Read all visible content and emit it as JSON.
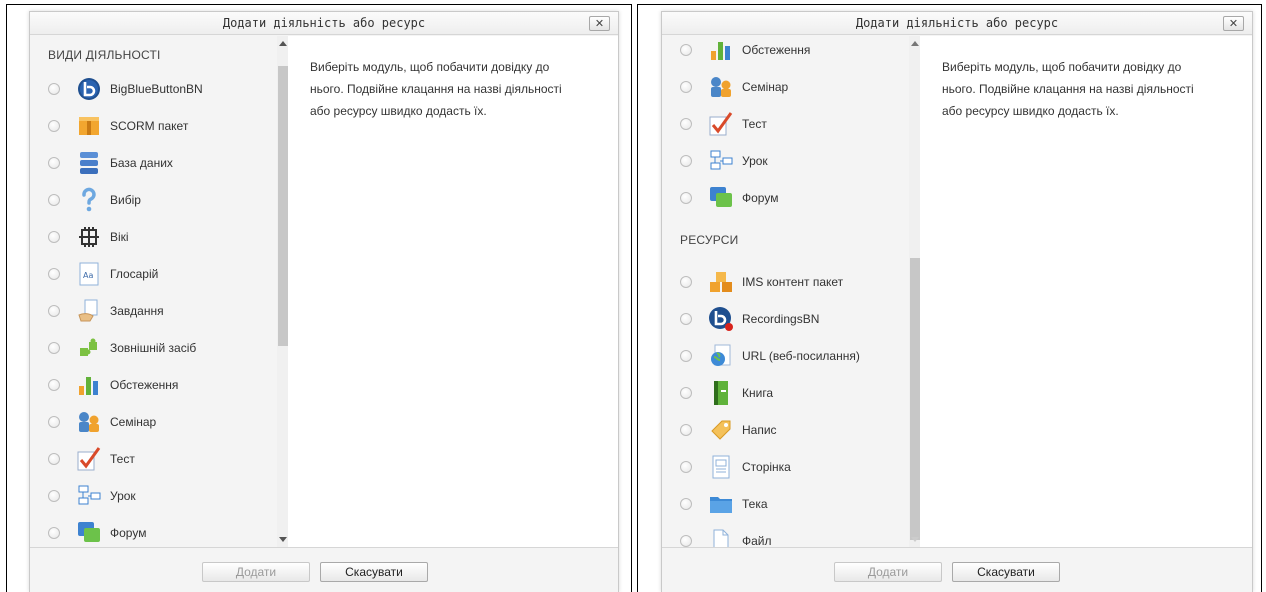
{
  "dialog": {
    "title": "Додати діяльність або ресурс",
    "close_symbol": "✕",
    "help_text": "Виберіть модуль, щоб побачити довідку до нього. Подвійне клацання на назві діяльності або ресурсу швидко додасть їх.",
    "add_label": "Додати",
    "cancel_label": "Скасувати"
  },
  "left_list": {
    "section_activities": "ВИДИ ДІЯЛЬНОСТІ",
    "items": [
      {
        "label": "BigBlueButtonBN",
        "icon": "bigbluebutton-icon"
      },
      {
        "label": "SCORM пакет",
        "icon": "scorm-package-icon"
      },
      {
        "label": "База даних",
        "icon": "database-icon"
      },
      {
        "label": "Вибір",
        "icon": "choice-question-icon"
      },
      {
        "label": "Вікі",
        "icon": "wiki-icon"
      },
      {
        "label": "Глосарій",
        "icon": "glossary-icon"
      },
      {
        "label": "Завдання",
        "icon": "assignment-icon"
      },
      {
        "label": "Зовнішній засіб",
        "icon": "external-tool-icon"
      },
      {
        "label": "Обстеження",
        "icon": "survey-icon"
      },
      {
        "label": "Семінар",
        "icon": "workshop-icon"
      },
      {
        "label": "Тест",
        "icon": "quiz-icon"
      },
      {
        "label": "Урок",
        "icon": "lesson-icon"
      },
      {
        "label": "Форум",
        "icon": "forum-icon"
      }
    ]
  },
  "right_list": {
    "activities_tail": [
      {
        "label": "Обстеження",
        "icon": "survey-icon"
      },
      {
        "label": "Семінар",
        "icon": "workshop-icon"
      },
      {
        "label": "Тест",
        "icon": "quiz-icon"
      },
      {
        "label": "Урок",
        "icon": "lesson-icon"
      },
      {
        "label": "Форум",
        "icon": "forum-icon"
      }
    ],
    "section_resources": "РЕСУРСИ",
    "resources": [
      {
        "label": "IMS контент пакет",
        "icon": "ims-package-icon"
      },
      {
        "label": "RecordingsBN",
        "icon": "recordings-icon"
      },
      {
        "label": "URL (веб-посилання)",
        "icon": "url-globe-icon"
      },
      {
        "label": "Книга",
        "icon": "book-icon"
      },
      {
        "label": "Напис",
        "icon": "label-tag-icon"
      },
      {
        "label": "Сторінка",
        "icon": "page-icon"
      },
      {
        "label": "Тека",
        "icon": "folder-icon"
      },
      {
        "label": "Файл",
        "icon": "file-icon"
      }
    ]
  },
  "colors": {
    "accent_blue": "#1f5fa8",
    "orange": "#f0a22e",
    "green": "#62b23a"
  }
}
